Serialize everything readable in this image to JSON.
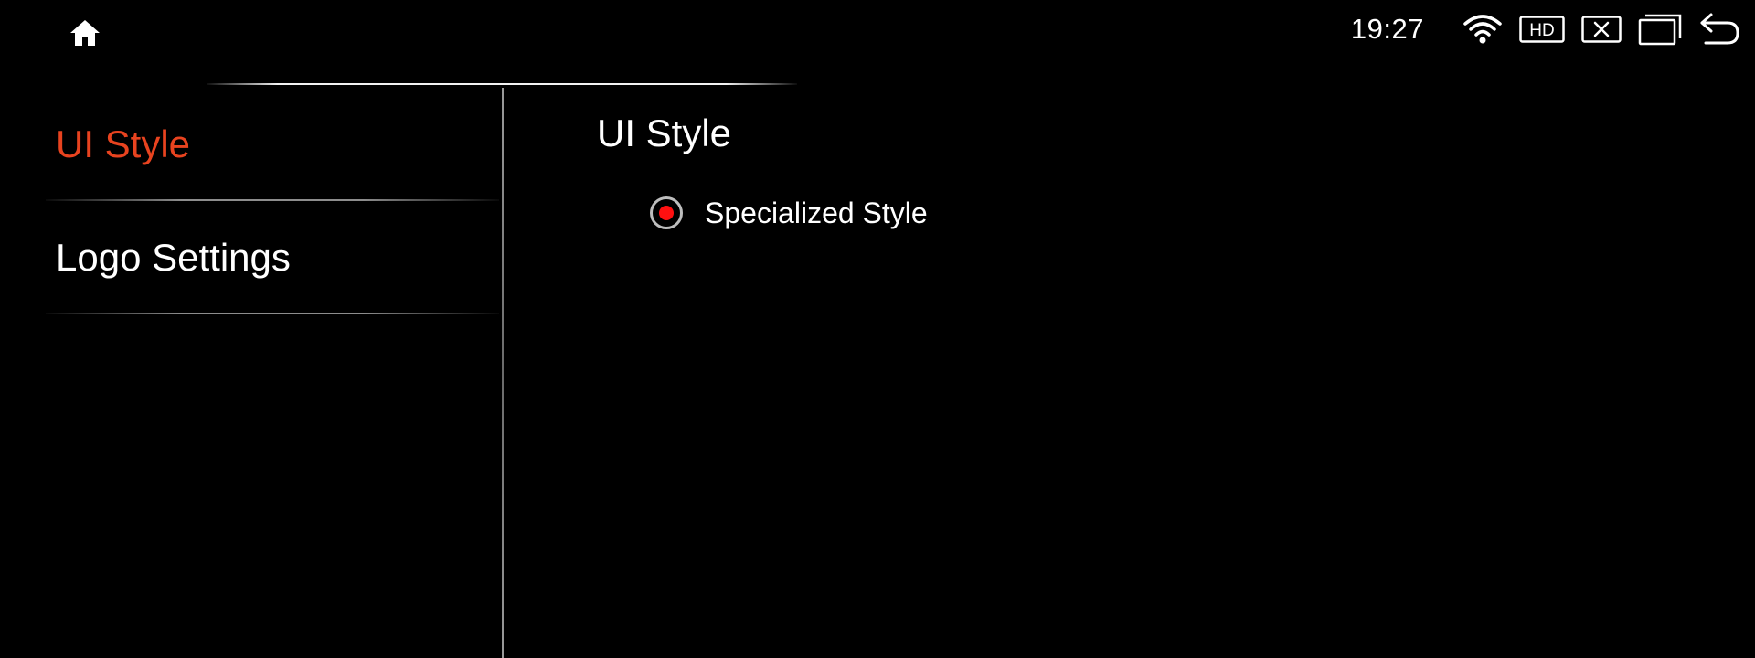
{
  "status_bar": {
    "home_icon": "home-icon",
    "time": "19:27",
    "wifi_icon": "wifi-icon",
    "hd_badge": "HD",
    "icons": [
      "wifi-icon",
      "hd-icon",
      "close-box-icon",
      "recent-apps-icon",
      "back-icon"
    ]
  },
  "sidebar": {
    "items": [
      {
        "label": "UI Style",
        "active": true
      },
      {
        "label": "Logo Settings",
        "active": false
      }
    ]
  },
  "content": {
    "title": "UI Style",
    "options": [
      {
        "label": "Specialized Style",
        "selected": true
      }
    ]
  },
  "colors": {
    "background": "#000000",
    "accent": "#e8431f",
    "radio_selected": "#ff1010",
    "text": "#ffffff"
  }
}
